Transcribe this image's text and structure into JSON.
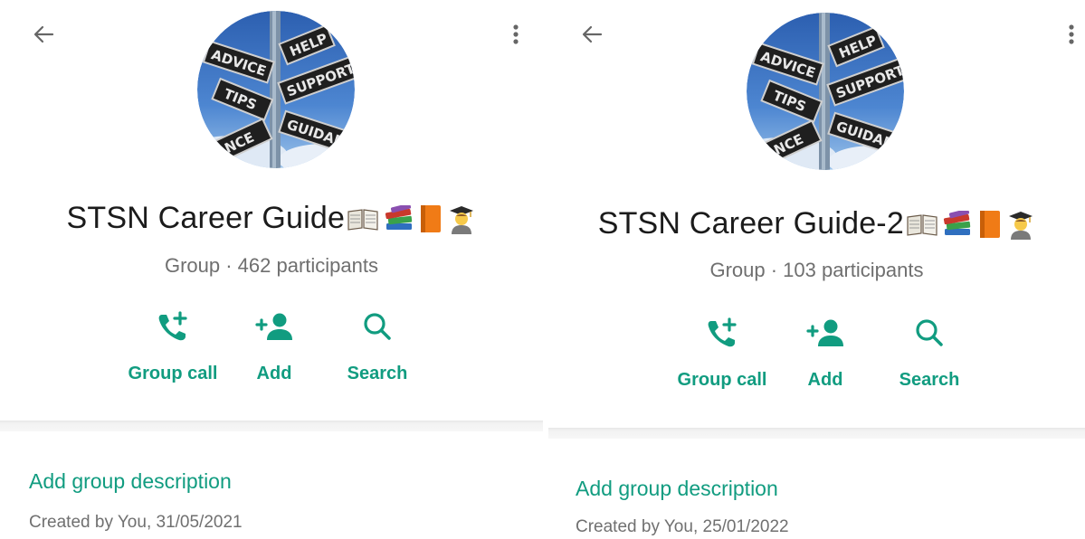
{
  "panels": [
    {
      "group_name": "STSN Career Guide",
      "subtitle": "Group · 462 participants",
      "actions": {
        "call_label": "Group call",
        "add_label": "Add",
        "search_label": "Search"
      },
      "description_link": "Add group description",
      "created_text": "Created by You, 31/05/2021",
      "avatar_signs": [
        "ADVICE",
        "HELP",
        "SUPPORT",
        "TIPS",
        "GUIDAN",
        "TANCE"
      ]
    },
    {
      "group_name": "STSN Career Guide-2",
      "subtitle": "Group · 103 participants",
      "actions": {
        "call_label": "Group call",
        "add_label": "Add",
        "search_label": "Search"
      },
      "description_link": "Add group description",
      "created_text": "Created by You, 25/01/2022",
      "avatar_signs": [
        "ADVICE",
        "HELP",
        "SUPPORT",
        "TIPS",
        "GUIDAN",
        "TANCE"
      ]
    }
  ],
  "title_emojis": [
    "open-book",
    "books-stack",
    "orange-book",
    "student"
  ],
  "colors": {
    "accent": "#119c80",
    "title": "#1b1b1b",
    "subtitle": "#6f6f6f",
    "meta": "#707070"
  }
}
